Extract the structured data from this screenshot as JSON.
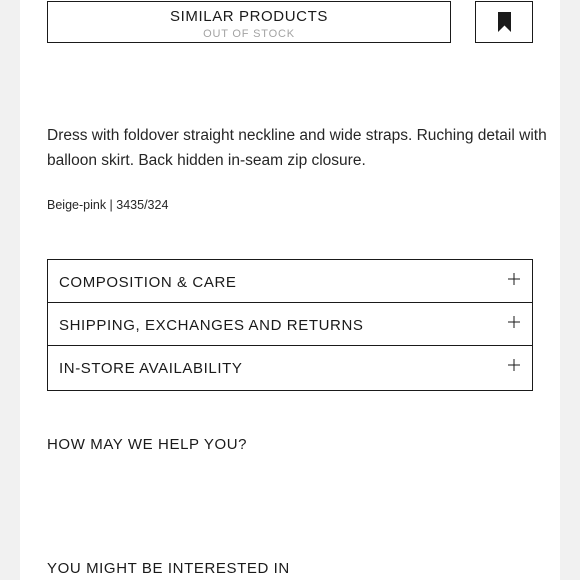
{
  "similar_products": {
    "label": "SIMILAR PRODUCTS",
    "status": "OUT OF STOCK"
  },
  "bookmark": {
    "icon": "bookmark-icon"
  },
  "product": {
    "description": "Dress with foldover straight neckline and wide straps. Ruching detail with balloon skirt. Back hidden in-seam zip closure.",
    "color_ref": "Beige-pink | 3435/324"
  },
  "accordion": {
    "items": [
      {
        "label": "COMPOSITION & CARE",
        "icon": "plus-icon"
      },
      {
        "label": "SHIPPING, EXCHANGES AND RETURNS",
        "icon": "plus-icon"
      },
      {
        "label": "IN-STORE AVAILABILITY",
        "icon": "plus-icon"
      }
    ]
  },
  "help": {
    "heading": "HOW MAY WE HELP YOU?"
  },
  "recommendations": {
    "heading": "YOU MIGHT BE INTERESTED IN"
  }
}
